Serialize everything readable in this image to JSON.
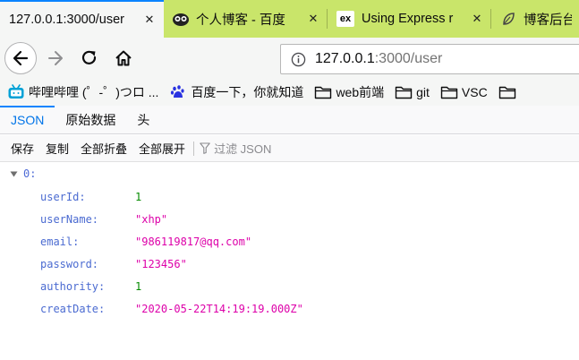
{
  "tabs": [
    {
      "title": "127.0.0.1:3000/user",
      "icon": "none",
      "active": true
    },
    {
      "title": "个人博客 - 百度",
      "icon": "owl-icon",
      "active": false
    },
    {
      "title": "Using Express r",
      "icon": "express-icon",
      "active": false
    },
    {
      "title": "博客后台",
      "icon": "leaf-icon",
      "active": false
    }
  ],
  "express_badge": "ex",
  "url": {
    "host": "127.0.0.1",
    "rest": ":3000/user"
  },
  "bookmarks": [
    {
      "label": "哔哩哔哩 (゜-゜)つロ ...",
      "icon": "bilibili-icon"
    },
    {
      "label": "百度一下，你就知道",
      "icon": "baidu-paw-icon"
    },
    {
      "label": "web前端",
      "icon": "folder-icon"
    },
    {
      "label": "git",
      "icon": "folder-icon"
    },
    {
      "label": "VSC",
      "icon": "folder-icon"
    },
    {
      "label": "",
      "icon": "folder-icon"
    }
  ],
  "viewer_tabs": [
    "JSON",
    "原始数据",
    "头"
  ],
  "toolbar": {
    "save": "保存",
    "copy": "复制",
    "collapse_all": "全部折叠",
    "expand_all": "全部展开",
    "filter_placeholder": "过滤 JSON"
  },
  "json": {
    "index_label": "0:",
    "fields": [
      {
        "key": "userId:",
        "value": "1",
        "type": "number"
      },
      {
        "key": "userName:",
        "value": "\"xhp\"",
        "type": "string"
      },
      {
        "key": "email:",
        "value": "\"986119817@qq.com\"",
        "type": "string"
      },
      {
        "key": "password:",
        "value": "\"123456\"",
        "type": "string"
      },
      {
        "key": "authority:",
        "value": "1",
        "type": "number"
      },
      {
        "key": "creatDate:",
        "value": "\"2020-05-22T14:19:19.000Z\"",
        "type": "string"
      }
    ]
  },
  "colors": {
    "tabstrip": "#c9e56a",
    "accent": "#0a84ff",
    "json_number": "#058b00",
    "json_string": "#dd00a9",
    "json_key": "#4b6bd1"
  }
}
